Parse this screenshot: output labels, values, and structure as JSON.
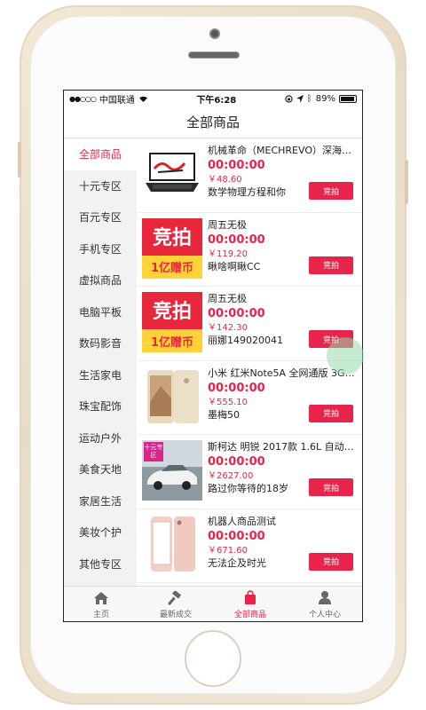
{
  "status": {
    "carrier": "中国联通",
    "time": "下午6:28",
    "battery": "89%"
  },
  "nav": {
    "title": "全部商品"
  },
  "sidebar": {
    "items": [
      {
        "label": "全部商品"
      },
      {
        "label": "十元专区"
      },
      {
        "label": "百元专区"
      },
      {
        "label": "手机专区"
      },
      {
        "label": "虚拟商品"
      },
      {
        "label": "电脑平板"
      },
      {
        "label": "数码影音"
      },
      {
        "label": "生活家电"
      },
      {
        "label": "珠宝配饰"
      },
      {
        "label": "运动户外"
      },
      {
        "label": "美食天地"
      },
      {
        "label": "家居生活"
      },
      {
        "label": "美妆个护"
      },
      {
        "label": "其他专区"
      }
    ]
  },
  "products": [
    {
      "title": "机械革命（MECHREVO）深海泰...",
      "timer": "00:00:00",
      "price": "￥48.60",
      "bidder": "数学物理方程和你",
      "button": "竞拍",
      "thumb": "laptop"
    },
    {
      "title": "周五无极",
      "timer": "00:00:00",
      "price": "￥119.20",
      "bidder": "瞅啥啊瞅CC",
      "button": "竞拍",
      "thumb": "promo",
      "thumb_text_top": "竞拍",
      "thumb_text_bottom": "1亿赠币"
    },
    {
      "title": "周五无极",
      "timer": "00:00:00",
      "price": "￥142.30",
      "bidder": "丽娜149020041",
      "button": "竞拍",
      "thumb": "promo",
      "thumb_text_top": "竞拍",
      "thumb_text_bottom": "1亿赠币"
    },
    {
      "title": "小米 红米Note5A 全网通版 3GB...",
      "timer": "00:00:00",
      "price": "￥555.10",
      "bidder": "墨梅50",
      "button": "竞拍",
      "thumb": "phone-gold"
    },
    {
      "title": "斯柯达 明锐 2017款 1.6L 自动前...",
      "timer": "00:00:00",
      "price": "￥2627.00",
      "bidder": "路过你等待的18岁",
      "button": "竞拍",
      "thumb": "car",
      "tag": "十元专区"
    },
    {
      "title": "机器人商品测试",
      "timer": "00:00:00",
      "price": "￥671.60",
      "bidder": "无法企及时光",
      "button": "竞拍",
      "thumb": "phone-rose"
    }
  ],
  "tabs": [
    {
      "label": "主页",
      "icon": "home-icon"
    },
    {
      "label": "最新成交",
      "icon": "hammer-icon"
    },
    {
      "label": "全部商品",
      "icon": "shopping-bag-icon"
    },
    {
      "label": "个人中心",
      "icon": "person-icon"
    }
  ],
  "colors": {
    "accent": "#e8244a",
    "tag": "#d6268a"
  }
}
